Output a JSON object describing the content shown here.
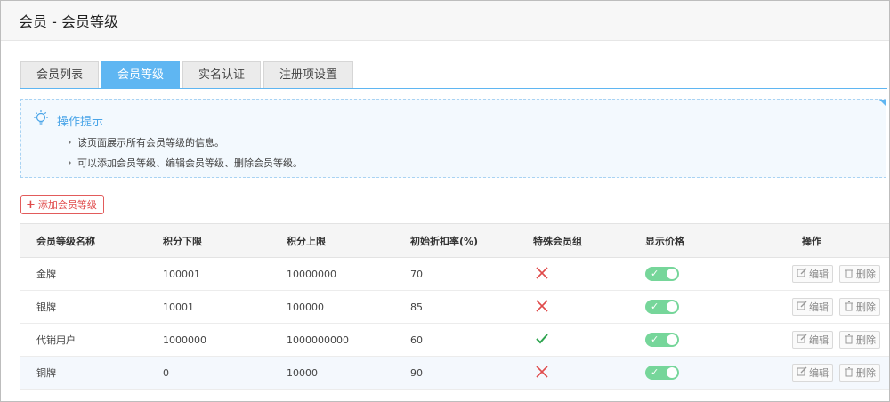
{
  "header": {
    "title": "会员 - 会员等级"
  },
  "tabs": [
    {
      "label": "会员列表",
      "active": false
    },
    {
      "label": "会员等级",
      "active": true
    },
    {
      "label": "实名认证",
      "active": false
    },
    {
      "label": "注册项设置",
      "active": false
    }
  ],
  "tips": {
    "title": "操作提示",
    "lines": [
      "该页面展示所有会员等级的信息。",
      "可以添加会员等级、编辑会员等级、删除会员等级。"
    ]
  },
  "add_button": {
    "label": "添加会员等级"
  },
  "table": {
    "columns": [
      "会员等级名称",
      "积分下限",
      "积分上限",
      "初始折扣率(%)",
      "特殊会员组",
      "显示价格",
      "操作"
    ],
    "edit_label": "编辑",
    "delete_label": "删除",
    "rows": [
      {
        "name": "金牌",
        "min": "100001",
        "max": "10000000",
        "rate": "70",
        "special": false,
        "show_price": true
      },
      {
        "name": "银牌",
        "min": "10001",
        "max": "100000",
        "rate": "85",
        "special": false,
        "show_price": true
      },
      {
        "name": "代销用户",
        "min": "1000000",
        "max": "1000000000",
        "rate": "60",
        "special": true,
        "show_price": true
      },
      {
        "name": "铜牌",
        "min": "0",
        "max": "10000",
        "rate": "90",
        "special": false,
        "show_price": true
      }
    ]
  },
  "colors": {
    "accent": "#5fb6f2",
    "cross": "#e04b4b",
    "check": "#2ea44f",
    "toggle_on": "#76d69a"
  }
}
